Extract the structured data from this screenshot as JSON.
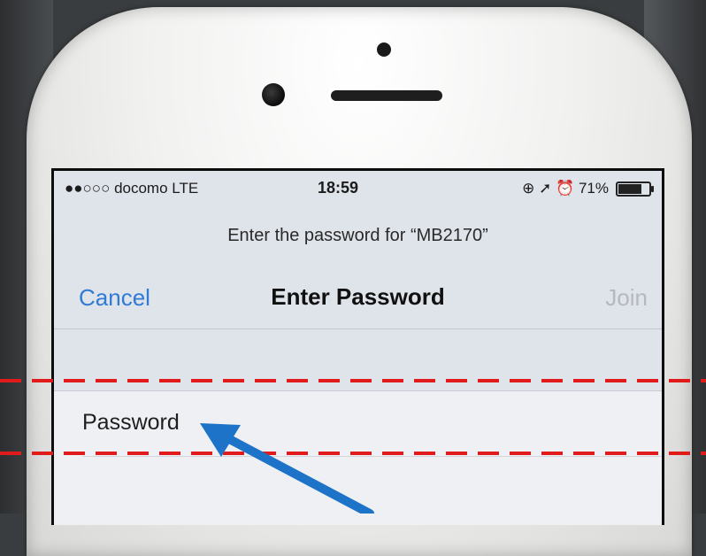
{
  "status_bar": {
    "signal_carrier": "●●○○○ docomo  LTE",
    "time": "18:59",
    "icons_text": "⊕ ➚ ⏰ 71%",
    "battery_level": 0.71
  },
  "dialog": {
    "prompt": "Enter the password for “MB2170”",
    "cancel_label": "Cancel",
    "title": "Enter Password",
    "join_label": "Join"
  },
  "password_field": {
    "placeholder": "Password",
    "value": ""
  },
  "colors": {
    "ios_blue": "#2f7bd6",
    "disabled_gray": "#b5b8bd",
    "annotation_red": "#e11b1b",
    "annotation_arrow": "#1d73c8"
  }
}
